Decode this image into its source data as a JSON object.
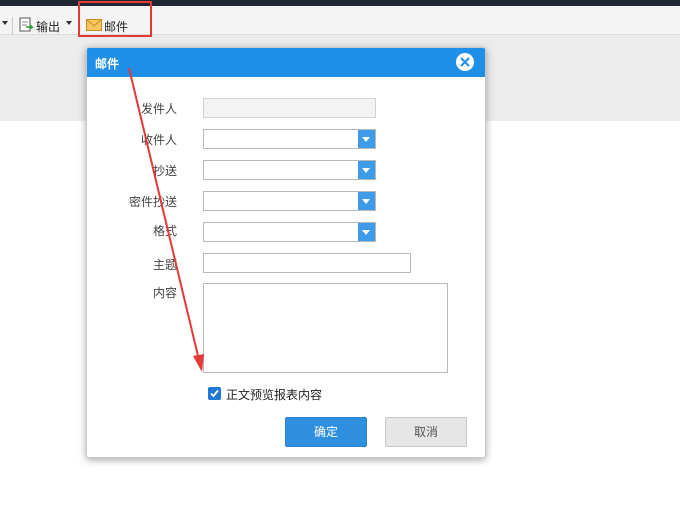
{
  "toolbar": {
    "export_label": "输出",
    "mail_label": "邮件"
  },
  "dialog": {
    "title": "邮件",
    "fields": {
      "sender": {
        "label": "发件人",
        "value": ""
      },
      "recipient": {
        "label": "收件人",
        "value": ""
      },
      "cc": {
        "label": "抄送",
        "value": ""
      },
      "bcc": {
        "label": "密件抄送",
        "value": ""
      },
      "format": {
        "label": "格式",
        "value": ""
      },
      "subject": {
        "label": "主题",
        "value": ""
      },
      "content": {
        "label": "内容",
        "value": ""
      }
    },
    "preview_checkbox": {
      "label": "正文预览报表内容",
      "checked": true
    },
    "ok_label": "确定",
    "cancel_label": "取消"
  },
  "colors": {
    "header_blue": "#1f8fe8",
    "combo_blue": "#3d9be9",
    "ok_blue": "#2f8fdf",
    "annotation_red": "#e53935"
  }
}
